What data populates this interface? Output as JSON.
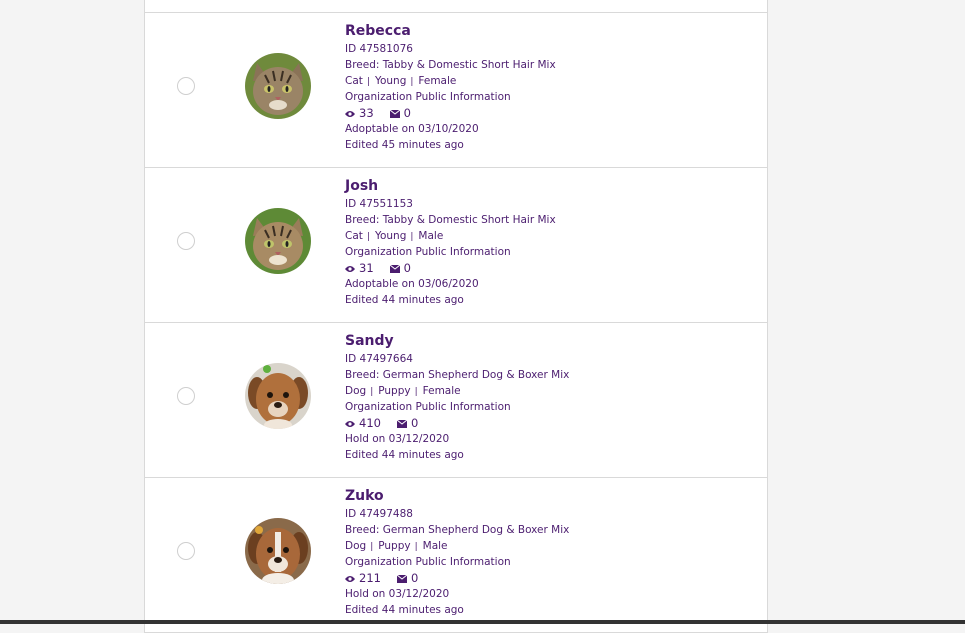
{
  "pets": [
    {
      "name": "Rebecca",
      "id_text": "ID 47581076",
      "breed_text": "Breed: Tabby & Domestic Short Hair Mix",
      "species": "Cat",
      "age": "Young",
      "sex": "Female",
      "org_info": "Organization Public Information",
      "views": "33",
      "messages": "0",
      "status_text": "Adoptable on 03/10/2020",
      "edited_text": "Edited 45 minutes ago",
      "photo": "tabby-cat-photo"
    },
    {
      "name": "Josh",
      "id_text": "ID 47551153",
      "breed_text": "Breed: Tabby & Domestic Short Hair Mix",
      "species": "Cat",
      "age": "Young",
      "sex": "Male",
      "org_info": "Organization Public Information",
      "views": "31",
      "messages": "0",
      "status_text": "Adoptable on 03/06/2020",
      "edited_text": "Edited 44 minutes ago",
      "photo": "tabby-cat-photo"
    },
    {
      "name": "Sandy",
      "id_text": "ID 47497664",
      "breed_text": "Breed: German Shepherd Dog & Boxer Mix",
      "species": "Dog",
      "age": "Puppy",
      "sex": "Female",
      "org_info": "Organization Public Information",
      "views": "410",
      "messages": "0",
      "status_text": "Hold on 03/12/2020",
      "edited_text": "Edited 44 minutes ago",
      "photo": "puppy-photo"
    },
    {
      "name": "Zuko",
      "id_text": "ID 47497488",
      "breed_text": "Breed: German Shepherd Dog & Boxer Mix",
      "species": "Dog",
      "age": "Puppy",
      "sex": "Male",
      "org_info": "Organization Public Information",
      "views": "211",
      "messages": "0",
      "status_text": "Hold on 03/12/2020",
      "edited_text": "Edited 44 minutes ago",
      "photo": "puppy-photo"
    }
  ],
  "colors": {
    "text": "#4b1d6f",
    "border": "#d9d9d9",
    "background": "#f4f4f4"
  },
  "icons": {
    "views": "eye-icon",
    "messages": "envelope-icon"
  }
}
